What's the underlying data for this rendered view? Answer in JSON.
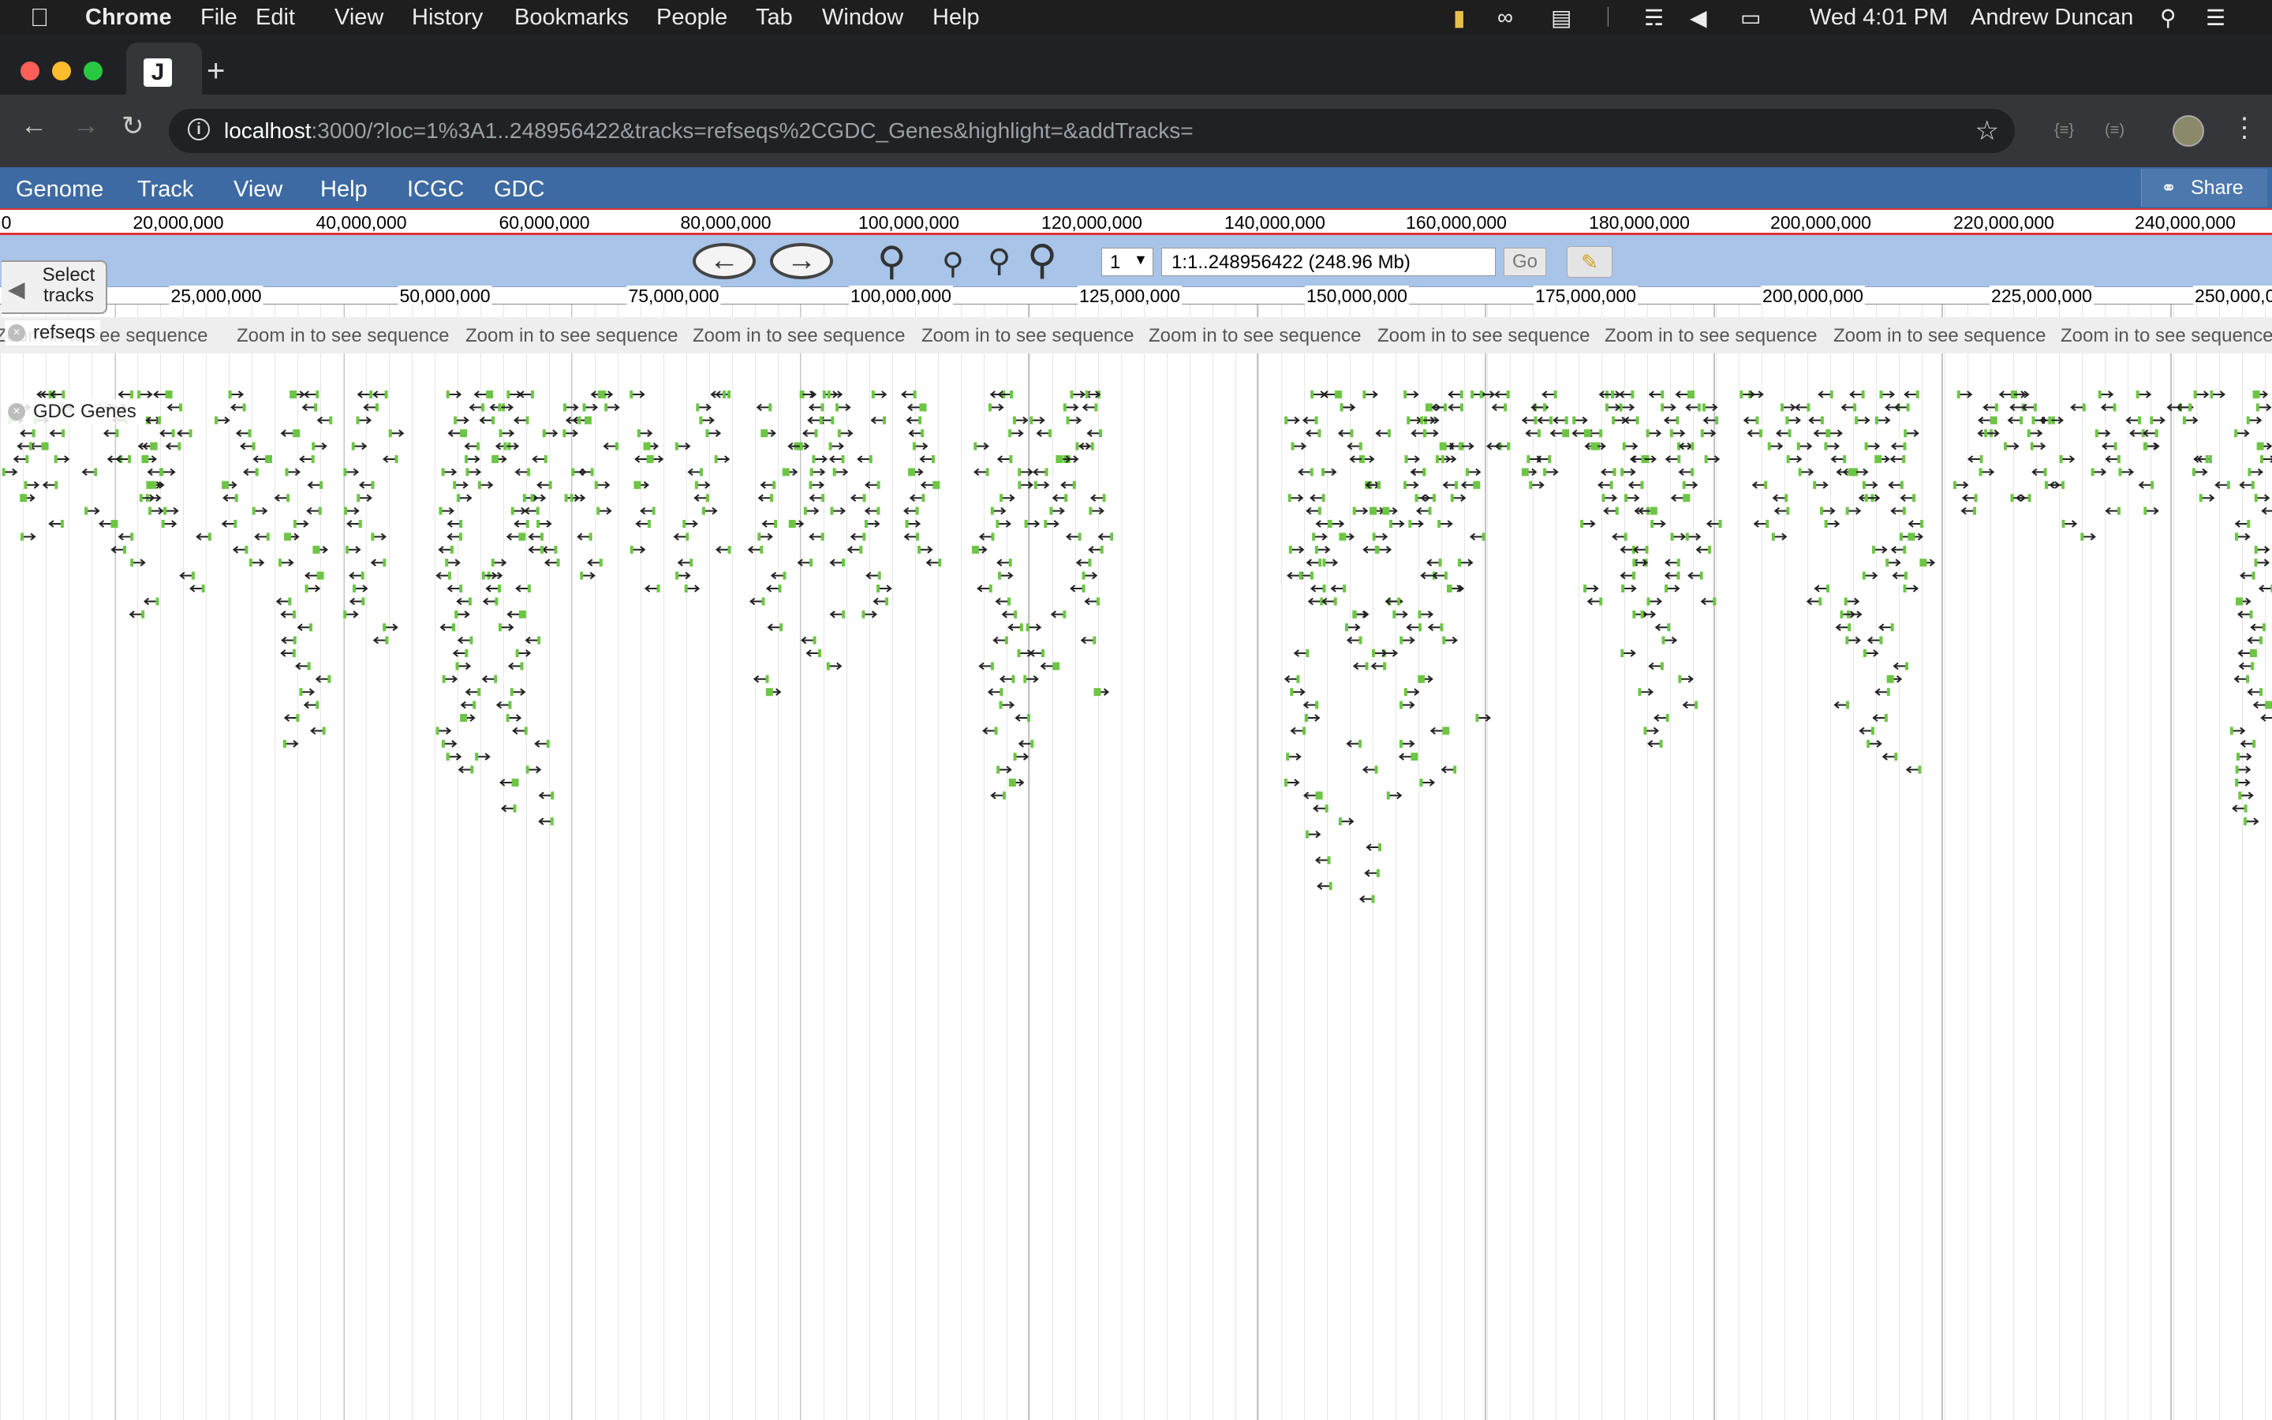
{
  "macos": {
    "app_name": "Chrome",
    "menus": [
      "File",
      "Edit",
      "View",
      "History",
      "Bookmarks",
      "People",
      "Tab",
      "Window",
      "Help"
    ],
    "clock": "Wed 4:01 PM",
    "user": "Andrew Duncan"
  },
  "browser": {
    "tab_favicon": "J",
    "url_host": "localhost",
    "url_rest": ":3000/?loc=1%3A1..248956422&tracks=refseqs%2CGDC_Genes&highlight=&addTracks="
  },
  "jbrowse": {
    "menus": [
      "Genome",
      "Track",
      "View",
      "Help",
      "ICGC",
      "GDC"
    ],
    "share_label": "Share",
    "overview_ticks": [
      "0",
      "20,000,000",
      "40,000,000",
      "60,000,000",
      "80,000,000",
      "100,000,000",
      "120,000,000",
      "140,000,000",
      "160,000,000",
      "180,000,000",
      "200,000,000",
      "220,000,000",
      "240,000,000"
    ],
    "refseq_selected": "1",
    "location_value": "1:1..248956422 (248.96 Mb)",
    "go_label": "Go",
    "detail_ticks": [
      "25,000,000",
      "50,000,000",
      "75,000,000",
      "100,000,000",
      "125,000,000",
      "150,000,000",
      "175,000,000",
      "200,000,000",
      "225,000,000",
      "250,000,000"
    ],
    "select_tracks_label": "Select tracks",
    "tracks": [
      {
        "label": "refseqs",
        "placeholder": "Zoom in to see sequence"
      },
      {
        "label": "GDC Genes"
      }
    ]
  },
  "icons": {
    "apple": "apple-logo-icon",
    "back": "back-arrow-icon",
    "forward": "forward-arrow-icon",
    "reload": "reload-icon",
    "bookmark": "star-icon",
    "menu": "kebab-menu-icon",
    "highlight": "highlighter-icon"
  },
  "colors": {
    "jbrowse_menu": "#3d6aa3",
    "nav_bar": "#a8c4e8",
    "overview_border": "#dd3333",
    "gene_green": "#6cc644",
    "gene_arrow": "#222222"
  }
}
